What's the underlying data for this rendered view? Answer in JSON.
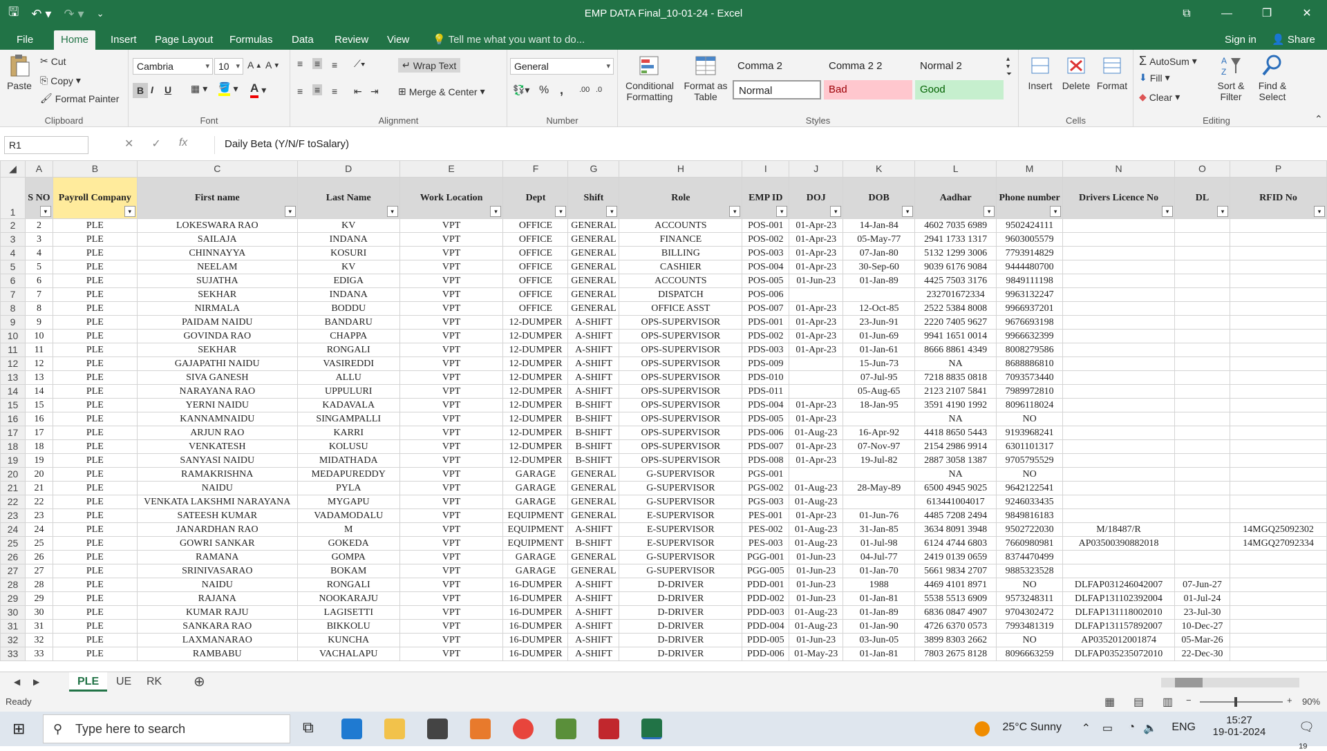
{
  "window": {
    "title": "EMP DATA Final_10-01-24 - Excel",
    "minimize": "—",
    "restore": "❐",
    "close": "✕"
  },
  "ribbon_tabs": [
    "File",
    "Home",
    "Insert",
    "Page Layout",
    "Formulas",
    "Data",
    "Review",
    "View"
  ],
  "tell_me": "Tell me what you want to do...",
  "signin": "Sign in",
  "share": "Share",
  "clipboard": {
    "paste": "Paste",
    "cut": "Cut",
    "copy": "Copy",
    "format_painter": "Format Painter",
    "label": "Clipboard"
  },
  "font": {
    "name": "Cambria",
    "size": "10",
    "label": "Font",
    "bold": "B",
    "italic": "I",
    "underline": "U"
  },
  "alignment": {
    "wrap": "Wrap Text",
    "merge": "Merge & Center",
    "label": "Alignment"
  },
  "number": {
    "format": "General",
    "label": "Number",
    "percent": "%",
    "comma": ","
  },
  "styles": {
    "cond": "Conditional Formatting",
    "table": "Format as Table",
    "label": "Styles",
    "cells": [
      {
        "text": "Comma 2",
        "bg": "#ffffff"
      },
      {
        "text": "Comma 2 2",
        "bg": "#ffffff"
      },
      {
        "text": "Normal 2",
        "bg": "#ffffff"
      },
      {
        "text": "Normal",
        "bg": "#ffffff"
      },
      {
        "text": "Bad",
        "bg": "#ffc7ce"
      },
      {
        "text": "Good",
        "bg": "#c6efce"
      }
    ]
  },
  "cells_group": {
    "insert": "Insert",
    "delete": "Delete",
    "format": "Format",
    "label": "Cells"
  },
  "editing": {
    "autosum": "AutoSum",
    "fill": "Fill",
    "clear": "Clear",
    "sort": "Sort & Filter",
    "find": "Find & Select",
    "label": "Editing"
  },
  "formula_bar": {
    "name_box": "R1",
    "formula": "Daily Beta (Y/N/F toSalary)"
  },
  "columns": [
    "A",
    "B",
    "C",
    "D",
    "E",
    "F",
    "G",
    "H",
    "I",
    "J",
    "K",
    "L",
    "M",
    "N",
    "O",
    "P"
  ],
  "headers": [
    "S NO",
    "Payroll Company",
    "First name",
    "Last Name",
    "Work Location",
    "Dept",
    "Shift",
    "Role",
    "EMP ID",
    "DOJ",
    "DOB",
    "Aadhar",
    "Phone number",
    "Drivers Licence No",
    "DL",
    "RFID No"
  ],
  "rows": [
    [
      "2",
      "PLE",
      "LOKESWARA RAO",
      "KV",
      "VPT",
      "OFFICE",
      "GENERAL",
      "ACCOUNTS",
      "POS-001",
      "01-Apr-23",
      "14-Jan-84",
      "4602 7035 6989",
      "9502424111",
      "",
      "",
      ""
    ],
    [
      "3",
      "PLE",
      "SAILAJA",
      "INDANA",
      "VPT",
      "OFFICE",
      "GENERAL",
      "FINANCE",
      "POS-002",
      "01-Apr-23",
      "05-May-77",
      "2941 1733 1317",
      "9603005579",
      "",
      "",
      ""
    ],
    [
      "4",
      "PLE",
      "CHINNAYYA",
      "KOSURI",
      "VPT",
      "OFFICE",
      "GENERAL",
      "BILLING",
      "POS-003",
      "01-Apr-23",
      "07-Jan-80",
      "5132 1299 3006",
      "7793914829",
      "",
      "",
      ""
    ],
    [
      "5",
      "PLE",
      "NEELAM",
      "KV",
      "VPT",
      "OFFICE",
      "GENERAL",
      "CASHIER",
      "POS-004",
      "01-Apr-23",
      "30-Sep-60",
      "9039 6176 9084",
      "9444480700",
      "",
      "",
      ""
    ],
    [
      "6",
      "PLE",
      "SUJATHA",
      "EDIGA",
      "VPT",
      "OFFICE",
      "GENERAL",
      "ACCOUNTS",
      "POS-005",
      "01-Jun-23",
      "01-Jan-89",
      "4425 7503 3176",
      "9849111198",
      "",
      "",
      ""
    ],
    [
      "7",
      "PLE",
      "SEKHAR",
      "INDANA",
      "VPT",
      "OFFICE",
      "GENERAL",
      "DISPATCH",
      "POS-006",
      "",
      "",
      "232701672334",
      "9963132247",
      "",
      "",
      ""
    ],
    [
      "8",
      "PLE",
      "NIRMALA",
      "BODDU",
      "VPT",
      "OFFICE",
      "GENERAL",
      "OFFICE ASST",
      "POS-007",
      "01-Apr-23",
      "12-Oct-85",
      "2522 5384 8008",
      "9966937201",
      "",
      "",
      ""
    ],
    [
      "9",
      "PLE",
      "PAIDAM NAIDU",
      "BANDARU",
      "VPT",
      "12-DUMPER",
      "A-SHIFT",
      "OPS-SUPERVISOR",
      "PDS-001",
      "01-Apr-23",
      "23-Jun-91",
      "2220 7405 9627",
      "9676693198",
      "",
      "",
      ""
    ],
    [
      "10",
      "PLE",
      "GOVINDA RAO",
      "CHAPPA",
      "VPT",
      "12-DUMPER",
      "A-SHIFT",
      "OPS-SUPERVISOR",
      "PDS-002",
      "01-Apr-23",
      "01-Jun-69",
      "9941 1651 0014",
      "9966632399",
      "",
      "",
      ""
    ],
    [
      "11",
      "PLE",
      "SEKHAR",
      "RONGALI",
      "VPT",
      "12-DUMPER",
      "A-SHIFT",
      "OPS-SUPERVISOR",
      "PDS-003",
      "01-Apr-23",
      "01-Jan-61",
      "8666 8861 4349",
      "8008279586",
      "",
      "",
      ""
    ],
    [
      "12",
      "PLE",
      "GAJAPATHI NAIDU",
      "VASIREDDI",
      "VPT",
      "12-DUMPER",
      "A-SHIFT",
      "OPS-SUPERVISOR",
      "PDS-009",
      "",
      "15-Jun-73",
      "NA",
      "8688886810",
      "",
      "",
      ""
    ],
    [
      "13",
      "PLE",
      "SIVA GANESH",
      "ALLU",
      "VPT",
      "12-DUMPER",
      "A-SHIFT",
      "OPS-SUPERVISOR",
      "PDS-010",
      "",
      "07-Jul-95",
      "7218 8835 0818",
      "7093573440",
      "",
      "",
      ""
    ],
    [
      "14",
      "PLE",
      "NARAYANA RAO",
      "UPPULURI",
      "VPT",
      "12-DUMPER",
      "A-SHIFT",
      "OPS-SUPERVISOR",
      "PDS-011",
      "",
      "05-Aug-65",
      "2123 2107 5841",
      "7989972810",
      "",
      "",
      ""
    ],
    [
      "15",
      "PLE",
      "YERNI NAIDU",
      "KADAVALA",
      "VPT",
      "12-DUMPER",
      "B-SHIFT",
      "OPS-SUPERVISOR",
      "PDS-004",
      "01-Apr-23",
      "18-Jan-95",
      "3591 4190 1992",
      "8096118024",
      "",
      "",
      ""
    ],
    [
      "16",
      "PLE",
      "KANNAMNAIDU",
      "SINGAMPALLI",
      "VPT",
      "12-DUMPER",
      "B-SHIFT",
      "OPS-SUPERVISOR",
      "PDS-005",
      "01-Apr-23",
      "",
      "NA",
      "NO",
      "",
      "",
      ""
    ],
    [
      "17",
      "PLE",
      "ARJUN RAO",
      "KARRI",
      "VPT",
      "12-DUMPER",
      "B-SHIFT",
      "OPS-SUPERVISOR",
      "PDS-006",
      "01-Aug-23",
      "16-Apr-92",
      "4418 8650 5443",
      "9193968241",
      "",
      "",
      ""
    ],
    [
      "18",
      "PLE",
      "VENKATESH",
      "KOLUSU",
      "VPT",
      "12-DUMPER",
      "B-SHIFT",
      "OPS-SUPERVISOR",
      "PDS-007",
      "01-Apr-23",
      "07-Nov-97",
      "2154 2986 9914",
      "6301101317",
      "",
      "",
      ""
    ],
    [
      "19",
      "PLE",
      "SANYASI NAIDU",
      "MIDATHADA",
      "VPT",
      "12-DUMPER",
      "B-SHIFT",
      "OPS-SUPERVISOR",
      "PDS-008",
      "01-Apr-23",
      "19-Jul-82",
      "2887 3058 1387",
      "9705795529",
      "",
      "",
      ""
    ],
    [
      "20",
      "PLE",
      "RAMAKRISHNA",
      "MEDAPUREDDY",
      "VPT",
      "GARAGE",
      "GENERAL",
      "G-SUPERVISOR",
      "PGS-001",
      "",
      "",
      "NA",
      "NO",
      "",
      "",
      ""
    ],
    [
      "21",
      "PLE",
      "NAIDU",
      "PYLA",
      "VPT",
      "GARAGE",
      "GENERAL",
      "G-SUPERVISOR",
      "PGS-002",
      "01-Aug-23",
      "28-May-89",
      "6500 4945 9025",
      "9642122541",
      "",
      "",
      ""
    ],
    [
      "22",
      "PLE",
      "VENKATA LAKSHMI NARAYANA",
      "MYGAPU",
      "VPT",
      "GARAGE",
      "GENERAL",
      "G-SUPERVISOR",
      "PGS-003",
      "01-Aug-23",
      "",
      "613441004017",
      "9246033435",
      "",
      "",
      ""
    ],
    [
      "23",
      "PLE",
      "SATEESH KUMAR",
      "VADAMODALU",
      "VPT",
      "EQUIPMENT",
      "GENERAL",
      "E-SUPERVISOR",
      "PES-001",
      "01-Apr-23",
      "01-Jun-76",
      "4485 7208 2494",
      "9849816183",
      "",
      "",
      ""
    ],
    [
      "24",
      "PLE",
      "JANARDHAN RAO",
      "M",
      "VPT",
      "EQUIPMENT",
      "A-SHIFT",
      "E-SUPERVISOR",
      "PES-002",
      "01-Aug-23",
      "31-Jan-85",
      "3634 8091 3948",
      "9502722030",
      "M/18487/R",
      "",
      "14MGQ25092302"
    ],
    [
      "25",
      "PLE",
      "GOWRI SANKAR",
      "GOKEDA",
      "VPT",
      "EQUIPMENT",
      "B-SHIFT",
      "E-SUPERVISOR",
      "PES-003",
      "01-Aug-23",
      "01-Jul-98",
      "6124 4744 6803",
      "7660980981",
      "AP03500390882018",
      "",
      "14MGQ27092334"
    ],
    [
      "26",
      "PLE",
      "RAMANA",
      "GOMPA",
      "VPT",
      "GARAGE",
      "GENERAL",
      "G-SUPERVISOR",
      "PGG-001",
      "01-Jun-23",
      "04-Jul-77",
      "2419 0139 0659",
      "8374470499",
      "",
      "",
      ""
    ],
    [
      "27",
      "PLE",
      "SRINIVASARAO",
      "BOKAM",
      "VPT",
      "GARAGE",
      "GENERAL",
      "G-SUPERVISOR",
      "PGG-005",
      "01-Jun-23",
      "01-Jan-70",
      "5661 9834 2707",
      "9885323528",
      "",
      "",
      ""
    ],
    [
      "28",
      "PLE",
      "NAIDU",
      "RONGALI",
      "VPT",
      "16-DUMPER",
      "A-SHIFT",
      "D-DRIVER",
      "PDD-001",
      "01-Jun-23",
      "1988",
      "4469 4101 8971",
      "NO",
      "DLFAP031246042007",
      "07-Jun-27",
      ""
    ],
    [
      "29",
      "PLE",
      "RAJANA",
      "NOOKARAJU",
      "VPT",
      "16-DUMPER",
      "A-SHIFT",
      "D-DRIVER",
      "PDD-002",
      "01-Jun-23",
      "01-Jan-81",
      "5538 5513 6909",
      "9573248311",
      "DLFAP131102392004",
      "01-Jul-24",
      ""
    ],
    [
      "30",
      "PLE",
      "KUMAR RAJU",
      "LAGISETTI",
      "VPT",
      "16-DUMPER",
      "A-SHIFT",
      "D-DRIVER",
      "PDD-003",
      "01-Aug-23",
      "01-Jan-89",
      "6836 0847 4907",
      "9704302472",
      "DLFAP131118002010",
      "23-Jul-30",
      ""
    ],
    [
      "31",
      "PLE",
      "SANKARA RAO",
      "BIKKOLU",
      "VPT",
      "16-DUMPER",
      "A-SHIFT",
      "D-DRIVER",
      "PDD-004",
      "01-Aug-23",
      "01-Jan-90",
      "4726 6370 0573",
      "7993481319",
      "DLFAP131157892007",
      "10-Dec-27",
      ""
    ],
    [
      "32",
      "PLE",
      "LAXMANARAO",
      "KUNCHA",
      "VPT",
      "16-DUMPER",
      "A-SHIFT",
      "D-DRIVER",
      "PDD-005",
      "01-Jun-23",
      "03-Jun-05",
      "3899 8303 2662",
      "NO",
      "AP0352012001874",
      "05-Mar-26",
      ""
    ],
    [
      "33",
      "PLE",
      "RAMBABU",
      "VACHALAPU",
      "VPT",
      "16-DUMPER",
      "A-SHIFT",
      "D-DRIVER",
      "PDD-006",
      "01-May-23",
      "01-Jan-81",
      "7803 2675 8128",
      "8096663259",
      "DLFAP035235072010",
      "22-Dec-30",
      ""
    ]
  ],
  "sheets": [
    "PLE",
    "UE",
    "RK"
  ],
  "status": {
    "ready": "Ready",
    "zoom": "90%"
  },
  "taskbar": {
    "search": "Type here to search",
    "weather": "25°C  Sunny",
    "lang": "ENG",
    "time": "15:27",
    "date": "19-01-2024",
    "notif": "19"
  }
}
